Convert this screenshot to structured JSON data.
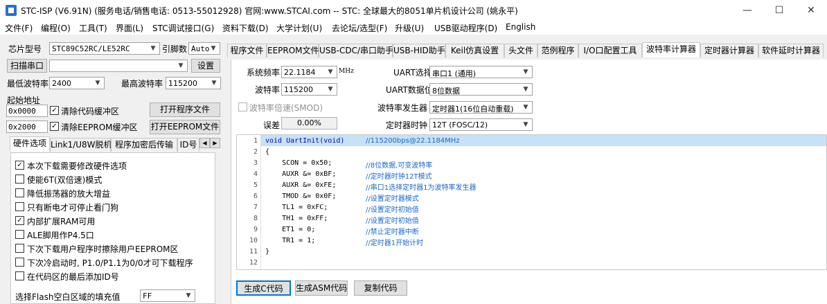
{
  "window": {
    "title": "STC-ISP (V6.91N) (服务电话/销售电话: 0513-55012928) 官网:www.STCAI.com  -- STC: 全球最大的8051单片机设计公司 (姚永平)",
    "minimize": "—",
    "maximize": "☐",
    "close": "✕"
  },
  "menu": [
    "文件(F)",
    "编程(O)",
    "工具(T)",
    "界面(L)",
    "STC调试接口(G)",
    "资料下载(D)",
    "大学计划(U)",
    "去论坛/选型(F)",
    "升级(U)",
    "USB驱动程序(D)",
    "English"
  ],
  "left": {
    "chip_label": "芯片型号",
    "chip_value": "STC89C52RC/LE52RC",
    "pin_label": "引脚数",
    "pin_value": "Auto",
    "scan_button": "扫描串口",
    "port_value": "",
    "settings_button": "设置",
    "min_baud_label": "最低波特率",
    "min_baud_value": "2400",
    "max_baud_label": "最高波特率",
    "max_baud_value": "115200",
    "start_addr_label": "起始地址",
    "addr1_value": "0x0000",
    "clear_code_label": "清除代码缓冲区",
    "open_program_button": "打开程序文件",
    "addr2_value": "0x2000",
    "clear_eeprom_label": "清除EEPROM缓冲区",
    "open_eeprom_button": "打开EEPROM文件",
    "tabs": [
      "硬件选项",
      "Link1/U8W脱机",
      "程序加密后传输",
      "ID号"
    ],
    "scroll_left": "◀",
    "scroll_right": "▶",
    "options": [
      {
        "label": "本次下载需要修改硬件选项",
        "checked": "✓"
      },
      {
        "label": "使能6T(双倍速)模式",
        "checked": ""
      },
      {
        "label": "降低振荡器的放大增益",
        "checked": ""
      },
      {
        "label": "只有断电才可停止看门狗",
        "checked": ""
      },
      {
        "label": "内部扩展RAM可用",
        "checked": "✓"
      },
      {
        "label": "ALE脚用作P4.5口",
        "checked": ""
      },
      {
        "label": "下次下载用户程序时擦除用户EEPROM区",
        "checked": ""
      },
      {
        "label": "下次冷启动时, P1.0/P1.1为0/0才可下载程序",
        "checked": ""
      },
      {
        "label": "在代码区的最后添加ID号",
        "checked": ""
      }
    ],
    "fill_label": "选择Flash空白区域的填充值",
    "fill_value": "FF"
  },
  "right": {
    "tabs": [
      "程序文件",
      "EEPROM文件",
      "USB-CDC/串口助手",
      "USB-HID助手",
      "Keil仿真设置",
      "头文件",
      "范例程序",
      "I/O口配置工具",
      "波特率计算器",
      "定时器计算器",
      "软件延时计算器"
    ],
    "freq_label": "系统频率",
    "freq_value": "22.1184",
    "freq_unit": "MHz",
    "baud_label": "波特率",
    "baud_value": "115200",
    "double_label": "波特率倍速(SMOD)",
    "error_label": "误差",
    "error_value": "0.00%",
    "uart_sel_label": "UART选择",
    "uart_sel_value": "串口1 (通用)",
    "uart_bits_label": "UART数据位",
    "uart_bits_value": "8位数据",
    "baud_gen_label": "波特率发生器",
    "baud_gen_value": "定时器1(16位自动重载)",
    "clock_label": "定时器时钟",
    "clock_value": "12T (FOSC/12)",
    "gen_c_button": "生成C代码",
    "gen_asm_button": "生成ASM代码",
    "copy_button": "复制代码"
  },
  "code_lines": [
    {
      "n": "1",
      "code": "void UartInit(void)",
      "comment": "//115200bps@22.1184MHz"
    },
    {
      "n": "2",
      "code": "{",
      "comment": ""
    },
    {
      "n": "3",
      "code": "    SCON = 0x50;",
      "comment": "//8位数据,可变波特率"
    },
    {
      "n": "4",
      "code": "    AUXR &= 0xBF;",
      "comment": "//定时器时钟12T模式"
    },
    {
      "n": "5",
      "code": "    AUXR &= 0xFE;",
      "comment": "//串口1选择定时器1为波特率发生器"
    },
    {
      "n": "6",
      "code": "    TMOD &= 0x0F;",
      "comment": "//设置定时器模式"
    },
    {
      "n": "7",
      "code": "    TL1 = 0xFC;",
      "comment": "//设置定时初始值"
    },
    {
      "n": "8",
      "code": "    TH1 = 0xFF;",
      "comment": "//设置定时初始值"
    },
    {
      "n": "9",
      "code": "    ET1 = 0;",
      "comment": "//禁止定时器中断"
    },
    {
      "n": "10",
      "code": "    TR1 = 1;",
      "comment": "//定时器1开始计时"
    },
    {
      "n": "11",
      "code": "}",
      "comment": ""
    },
    {
      "n": "12",
      "code": "",
      "comment": ""
    }
  ]
}
